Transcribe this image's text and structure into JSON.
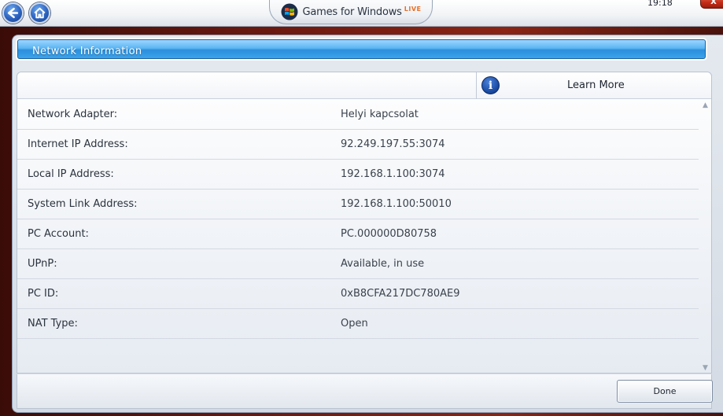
{
  "topbar": {
    "brand_text": "Games for Windows",
    "brand_live": "LIVE",
    "clock": "19:18",
    "close_label": "X",
    "back_icon": "back-arrow-icon",
    "home_icon": "home-icon"
  },
  "panel": {
    "title": "Network Information",
    "learn_more": "Learn More",
    "done_label": "Done"
  },
  "rows": [
    {
      "label": "Network Adapter:",
      "value": "Helyi kapcsolat"
    },
    {
      "label": "Internet IP Address:",
      "value": "92.249.197.55:3074"
    },
    {
      "label": "Local IP Address:",
      "value": "192.168.1.100:3074"
    },
    {
      "label": "System Link Address:",
      "value": "192.168.1.100:50010"
    },
    {
      "label": "PC Account:",
      "value": "PC.000000D80758"
    },
    {
      "label": "UPnP:",
      "value": "Available, in use"
    },
    {
      "label": "PC ID:",
      "value": "0xB8CFA217DC780AE9"
    },
    {
      "label": "NAT Type:",
      "value": "Open"
    }
  ],
  "colors": {
    "accent": "#2c8edc",
    "background": "#6e1a10",
    "close": "#c42c17"
  }
}
